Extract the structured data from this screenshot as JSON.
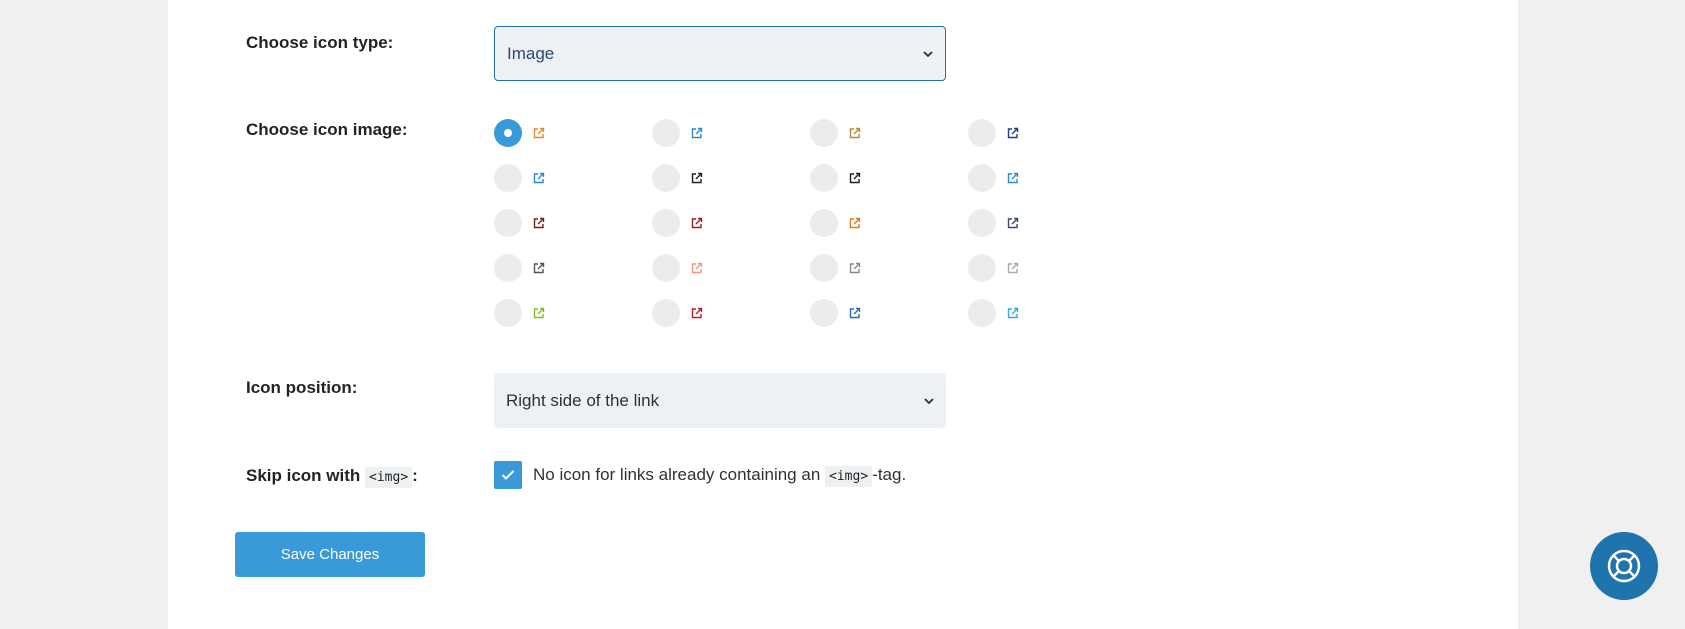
{
  "fields": {
    "icon_type": {
      "label": "Choose icon type:",
      "value": "Image"
    },
    "icon_image": {
      "label": "Choose icon image:",
      "selected_index": 0,
      "options": [
        {
          "icon": "external-link-icon",
          "color": "#e0892e"
        },
        {
          "icon": "external-link-icon",
          "color": "#2a8ad1"
        },
        {
          "icon": "external-link-icon",
          "color": "#b58a3a"
        },
        {
          "icon": "external-link-icon",
          "color": "#1f3f8f"
        },
        {
          "icon": "external-link-icon",
          "color": "#2a8ad1"
        },
        {
          "icon": "external-link-icon",
          "color": "#222222"
        },
        {
          "icon": "external-link-icon",
          "color": "#222222"
        },
        {
          "icon": "external-link-icon",
          "color": "#2a8ad1"
        },
        {
          "icon": "external-link-icon",
          "color": "#7a1f1f"
        },
        {
          "icon": "external-link-icon",
          "color": "#9b1c1c"
        },
        {
          "icon": "external-link-icon",
          "color": "#e07a1e"
        },
        {
          "icon": "external-link-icon",
          "color": "#3d4a6b"
        },
        {
          "icon": "external-link-icon",
          "color": "#555555"
        },
        {
          "icon": "external-link-icon",
          "color": "#f09a7a"
        },
        {
          "icon": "external-link-icon",
          "color": "#888888"
        },
        {
          "icon": "external-link-icon",
          "color": "#aaaaaa"
        },
        {
          "icon": "external-link-icon",
          "color": "#7fbf1f"
        },
        {
          "icon": "external-link-icon",
          "color": "#b22222"
        },
        {
          "icon": "external-link-icon",
          "color": "#1f6fbf"
        },
        {
          "icon": "external-link-icon",
          "color": "#3aa6d9"
        }
      ]
    },
    "icon_position": {
      "label": "Icon position:",
      "value": "Right side of the link"
    },
    "skip_icon": {
      "label_prefix": "Skip icon with",
      "label_code": "<img>",
      "label_suffix": ":",
      "checked": true,
      "text_prefix": "No icon for links already containing an",
      "text_code": "<img>",
      "text_suffix": "-tag."
    }
  },
  "save_button": "Save Changes",
  "help_button_icon": "lifebuoy-icon",
  "colors": {
    "accent": "#3a9ad9",
    "help": "#1f74ad",
    "background": "#f0f0f1"
  }
}
